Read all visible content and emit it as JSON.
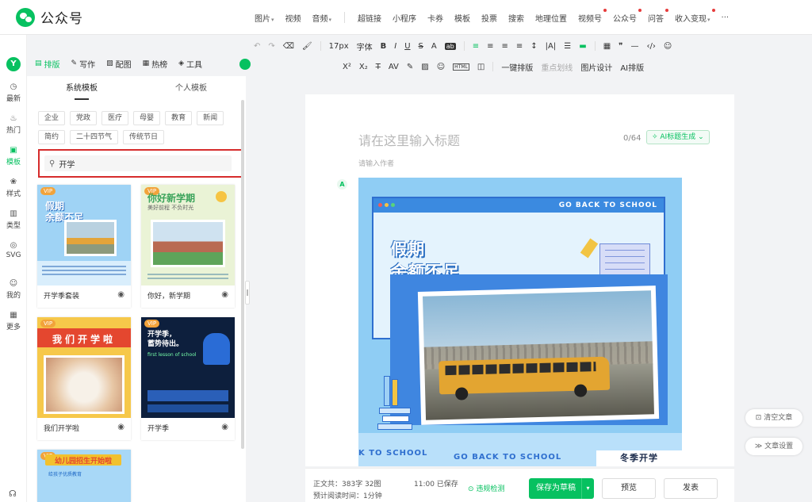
{
  "brand": {
    "name": "公众号"
  },
  "top_menu": {
    "media": [
      "图片",
      "视频",
      "音频"
    ],
    "items": [
      {
        "label": "超链接",
        "dot": false
      },
      {
        "label": "小程序",
        "dot": false
      },
      {
        "label": "卡券",
        "dot": false
      },
      {
        "label": "模板",
        "dot": false
      },
      {
        "label": "投票",
        "dot": false
      },
      {
        "label": "搜索",
        "dot": false
      },
      {
        "label": "地理位置",
        "dot": false
      },
      {
        "label": "视频号",
        "dot": true
      },
      {
        "label": "公众号",
        "dot": true
      },
      {
        "label": "问答",
        "dot": true
      },
      {
        "label": "收入变现",
        "dot": true
      }
    ],
    "more": "···"
  },
  "toolbar": {
    "undo": "↶",
    "redo": "↷",
    "eraser": "⌫",
    "format_brush": "🖌",
    "font_size": "17px",
    "font_label": "字体",
    "bold": "B",
    "italic": "I",
    "underline": "U",
    "strike": "S",
    "font_color": "A",
    "bg_color": "ab",
    "align_left": "≡",
    "align_center": "≡",
    "align_right": "≡",
    "indent": "≡",
    "line_height": "↕",
    "letter_space": "|A|",
    "list": "☰",
    "divider_color": "▬",
    "table": "▦",
    "quote": "❞",
    "line": "—",
    "code": "‹/›",
    "emoji": "☺",
    "sup": "X²",
    "sub": "X₂",
    "clear_format": "T̶",
    "letter_spacing": "AV",
    "magic": "✎",
    "image": "▨",
    "emoji2": "☺",
    "html": "HTML",
    "camera": "◫",
    "one_click_layout": "一键排版",
    "highlight_mark": "重点划线",
    "image_design": "图片设计",
    "ai_layout": "AI排版"
  },
  "rail": {
    "logo": "Y",
    "items": [
      {
        "icon": "◷",
        "label": "最新"
      },
      {
        "icon": "♨",
        "label": "热门"
      },
      {
        "icon": "▣",
        "label": "模板"
      },
      {
        "icon": "❀",
        "label": "样式"
      },
      {
        "icon": "▥",
        "label": "类型"
      },
      {
        "icon": "◎",
        "label": "SVG"
      },
      {
        "icon": "☺",
        "label": "我的"
      },
      {
        "icon": "▦",
        "label": "更多"
      }
    ],
    "bottom_icon": "☊"
  },
  "panel_tabs": [
    {
      "icon": "▤",
      "label": "排版"
    },
    {
      "icon": "✎",
      "label": "写作"
    },
    {
      "icon": "▨",
      "label": "配图"
    },
    {
      "icon": "▦",
      "label": "热榜"
    },
    {
      "icon": "◈",
      "label": "工具"
    }
  ],
  "template_panel": {
    "subtabs": [
      "系统模板",
      "个人模板"
    ],
    "categories": [
      "企业",
      "党政",
      "医疗",
      "母婴",
      "教育",
      "新闻",
      "简约",
      "二十四节气",
      "传统节日"
    ],
    "search": {
      "icon": "⚲",
      "value": "开学"
    },
    "cards": [
      {
        "name": "开学季套装",
        "vip": "VIP",
        "headline": "假期\n余额不足",
        "eye": "◉"
      },
      {
        "name": "你好，新学期",
        "vip": "VIP",
        "headline": "你好新学期",
        "sub": "美好前程 不负时光",
        "eye": "◉"
      },
      {
        "name": "我们开学啦",
        "vip": "VIP",
        "headline": "我们开学啦",
        "eye": "◉"
      },
      {
        "name": "开学季",
        "vip": "VIP",
        "headline": "开学季，\n蓄势待出。",
        "sub": "first lesson of school",
        "eye": "◉"
      },
      {
        "name": "",
        "vip": "VIP",
        "headline": "幼儿园招生开始啦",
        "sub": "给孩子优质教育",
        "eye": ""
      }
    ]
  },
  "handle_icon": "‖",
  "editor": {
    "title_placeholder": "请在这里输入标题",
    "title_count": "0/64",
    "ai_title_button": "✧ AI标题生成 ⌄",
    "author_placeholder": "请输入作者",
    "ai_badge": "A",
    "poster": {
      "top_text": "GO BACK TO SCHOOL",
      "headline_line1": "假期",
      "headline_line2": "余额不足",
      "bottom_text_1": "K TO SCHOOL",
      "bottom_text_2": "GO BACK TO SCHOOL",
      "badge": "冬季开学"
    }
  },
  "floating": {
    "clear": "⊡ 清空文章",
    "settings": "≫ 文章设置"
  },
  "bottom_bar": {
    "word_count_label": "正文共：",
    "word_count_value": "383字 32图",
    "read_time_label": "预计阅读时间：",
    "read_time_value": "1分钟",
    "saved": "11:00  已保存",
    "violation_check": "⊙ 违规检测",
    "save_draft": "保存为草稿",
    "draft_arrow": "▾",
    "preview": "预览",
    "publish": "发表"
  },
  "colors": {
    "brand_green": "#07c160",
    "search_highlight": "#d62c2c"
  }
}
